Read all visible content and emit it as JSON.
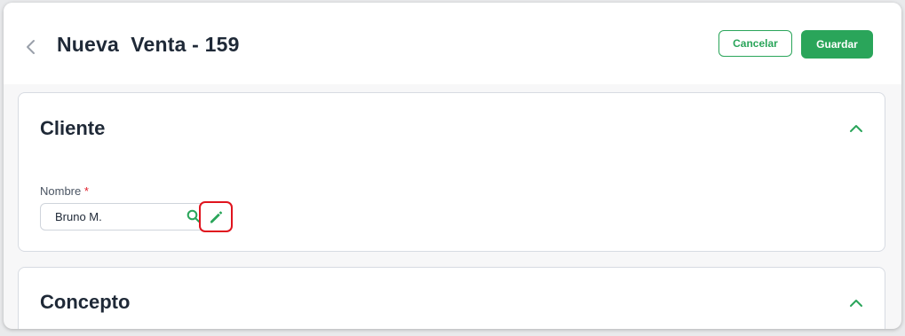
{
  "header": {
    "title": "Nueva  Venta - 159",
    "cancel_label": "Cancelar",
    "save_label": "Guardar",
    "back_icon": "chevron-left-icon"
  },
  "sections": {
    "cliente": {
      "title": "Cliente",
      "expanded": true,
      "fields": {
        "nombre": {
          "label": "Nombre",
          "required_mark": "*",
          "value": "Bruno M."
        }
      }
    },
    "concepto": {
      "title": "Concepto",
      "expanded": true
    }
  },
  "colors": {
    "accent": "#2aa55a",
    "required": "#e11d2a",
    "highlight": "#e0141e"
  }
}
